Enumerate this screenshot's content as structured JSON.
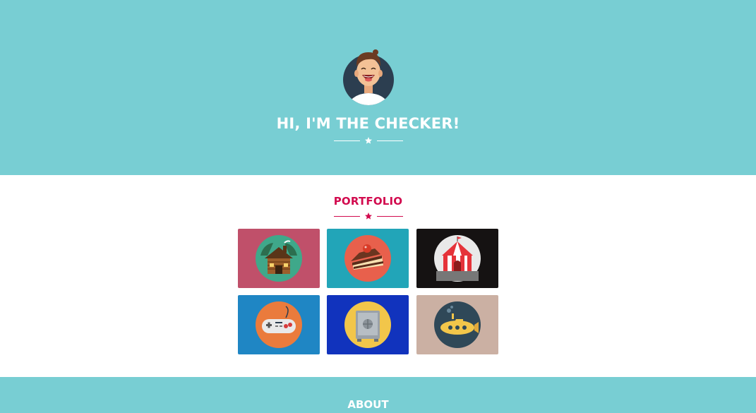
{
  "hero": {
    "title": "HI, I'M THE CHECKER!",
    "background": "#78ced3",
    "avatar_icon": "avatar-boy-laughing",
    "divider_icon": "star-icon"
  },
  "portfolio": {
    "title": "PORTFOLIO",
    "accent": "#d20a4e",
    "items": [
      {
        "icon": "log-cabin-icon",
        "background": "#c0506a"
      },
      {
        "icon": "cake-slice-icon",
        "background": "#22a5b8"
      },
      {
        "icon": "circus-tent-icon",
        "background": "#151212"
      },
      {
        "icon": "game-controller-icon",
        "background": "#1f86c4"
      },
      {
        "icon": "safe-vault-icon",
        "background": "#1133bd"
      },
      {
        "icon": "submarine-icon",
        "background": "#cbb0a3"
      }
    ]
  },
  "about": {
    "title": "ABOUT",
    "background": "#78ced3"
  }
}
